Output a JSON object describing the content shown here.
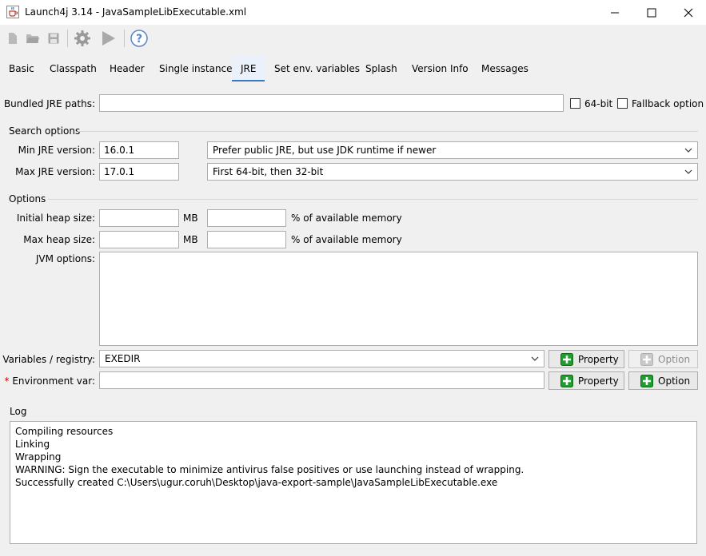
{
  "window": {
    "title": "Launch4j 3.14 - JavaSampleLibExecutable.xml",
    "icon": "java-cup-icon"
  },
  "toolbar": {
    "items": [
      "new-file-icon",
      "open-folder-icon",
      "save-icon",
      "build-gear-icon",
      "run-icon",
      "help-icon"
    ]
  },
  "tabs": [
    {
      "label": "Basic"
    },
    {
      "label": "Classpath"
    },
    {
      "label": "Header"
    },
    {
      "label": "Single instance"
    },
    {
      "label": "JRE",
      "active": true
    },
    {
      "label": "Set env. variables"
    },
    {
      "label": "Splash"
    },
    {
      "label": "Version Info"
    },
    {
      "label": "Messages"
    }
  ],
  "jre": {
    "bundled_label": "Bundled JRE paths:",
    "bundled_value": "",
    "bit64_label": "64-bit",
    "bit64_checked": false,
    "fallback_label": "Fallback option",
    "fallback_checked": false
  },
  "search": {
    "title": "Search options",
    "min_label": "Min JRE version:",
    "min_value": "16.0.1",
    "max_label": "Max JRE version:",
    "max_value": "17.0.1",
    "preference_value": "Prefer public JRE, but use JDK runtime if newer",
    "arch_value": "First 64-bit, then 32-bit"
  },
  "options": {
    "title": "Options",
    "initial_heap_label": "Initial heap size:",
    "initial_heap_value": "",
    "max_heap_label": "Max heap size:",
    "max_heap_value": "",
    "mb_unit": "MB",
    "percent_label": "% of available memory",
    "jvm_label": "JVM options:",
    "vars_label": "Variables / registry:",
    "vars_value": "EXEDIR",
    "env_required": "*",
    "env_label": " Environment var:",
    "env_value": "",
    "property_button": "Property",
    "option_button": "Option"
  },
  "log": {
    "title": "Log",
    "lines": [
      "Compiling resources",
      "Linking",
      "Wrapping",
      "WARNING: Sign the executable to minimize antivirus false positives or use launching instead of wrapping.",
      "Successfully created C:\\Users\\ugur.coruh\\Desktop\\java-export-sample\\JavaSampleLibExecutable.exe"
    ]
  },
  "colors": {
    "accent": "#3c78c8",
    "active_tab_bg": "#eaf1fb",
    "required": "#d00000",
    "plus_green": "#1e9e2e"
  }
}
